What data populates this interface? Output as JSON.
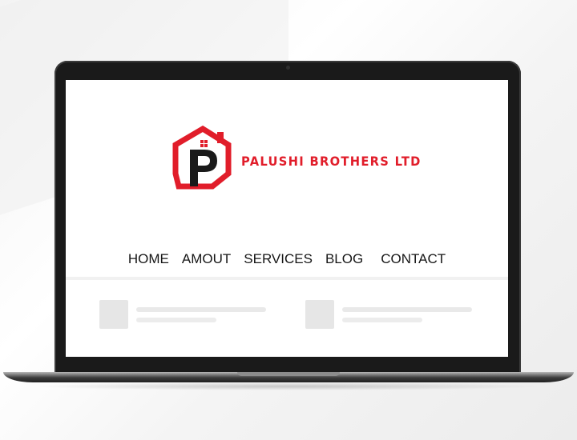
{
  "brand": {
    "name": "PALUSHI BROTHERS LTD",
    "colors": {
      "red": "#e11d2a",
      "dark": "#1a1a1a"
    }
  },
  "nav": {
    "items": [
      {
        "label": "HOME"
      },
      {
        "label": "AMOUT"
      },
      {
        "label": "SERVICES"
      },
      {
        "label": "BLOG"
      },
      {
        "label": "CONTACT"
      }
    ]
  }
}
